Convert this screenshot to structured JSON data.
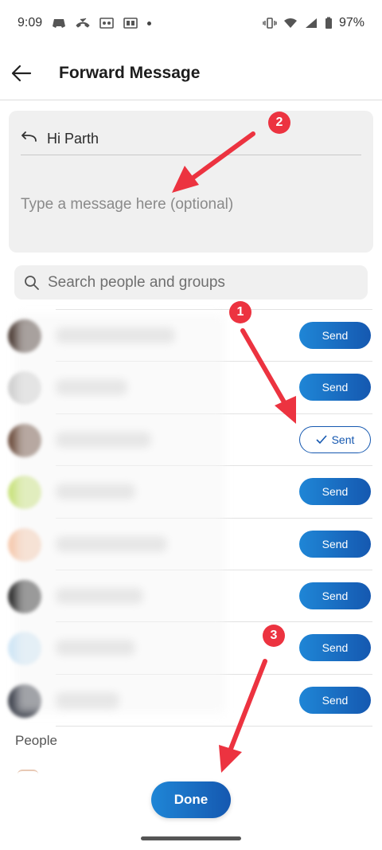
{
  "status_bar": {
    "time": "9:09",
    "battery": "97%",
    "icons_left": [
      "discord-icon",
      "missed-call-icon",
      "voicemail-icon",
      "cast-icon",
      "dot-icon"
    ],
    "icons_right": [
      "vibrate-icon",
      "wifi-icon",
      "signal-icon",
      "battery-icon"
    ]
  },
  "header": {
    "title": "Forward Message"
  },
  "compose": {
    "quoted_message": "Hi Parth",
    "placeholder": "Type a message here (optional)"
  },
  "search": {
    "placeholder": "Search people and groups"
  },
  "contacts": [
    {
      "action": "Send",
      "state": "send",
      "avatar_color": "#4a3a33",
      "name_width": 150
    },
    {
      "action": "Send",
      "state": "send",
      "avatar_color": "#cfcfcf",
      "name_width": 90
    },
    {
      "action": "Sent",
      "state": "sent",
      "avatar_color": "#6a4a3a",
      "name_width": 120
    },
    {
      "action": "Send",
      "state": "send",
      "avatar_color": "#c8e27a",
      "name_width": 100
    },
    {
      "action": "Send",
      "state": "send",
      "avatar_color": "#f6c9ad",
      "name_width": 140
    },
    {
      "action": "Send",
      "state": "send",
      "avatar_color": "#2a2a2a",
      "name_width": 110
    },
    {
      "action": "Send",
      "state": "send",
      "avatar_color": "#cfe6f6",
      "name_width": 100
    },
    {
      "action": "Send",
      "state": "send",
      "avatar_color": "#3b3f4a",
      "name_width": 80
    }
  ],
  "section": {
    "people_label": "People"
  },
  "footer": {
    "done_label": "Done"
  },
  "annotations": {
    "marker_1": "1",
    "marker_2": "2",
    "marker_3": "3",
    "color": "#ec3340"
  },
  "colors": {
    "accent": "#1558b0",
    "accent_light": "#1f86d6"
  }
}
